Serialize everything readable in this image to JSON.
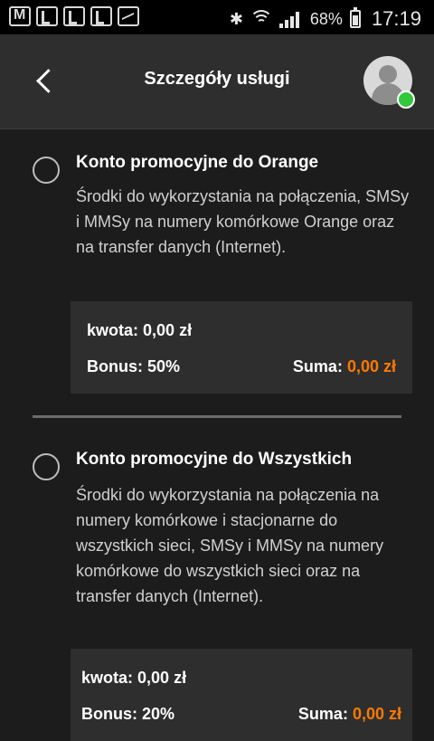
{
  "statusbar": {
    "battery": "68%",
    "time": "17:19",
    "icons": [
      "gmail-icon",
      "app-icon",
      "app-icon",
      "app-icon",
      "gallery-icon",
      "bluetooth-icon",
      "wifi-icon",
      "signal-icon",
      "battery-icon"
    ]
  },
  "header": {
    "title": "Szczegóły usługi"
  },
  "offers": [
    {
      "title": "Konto promocyjne do Orange",
      "description": "Środki do wykorzystania na połączenia, SMSy i MMSy na numery komórkowe Orange oraz na transfer danych (Internet).",
      "amount_label": "kwota:",
      "amount_value": "0,00 zł",
      "bonus_label": "Bonus:",
      "bonus_value": "50%",
      "sum_label": "Suma:",
      "sum_value": "0,00 zł"
    },
    {
      "title": "Konto promocyjne do Wszystkich",
      "description": "Środki do wykorzystania na połączenia na numery komórkowe i stacjonarne do wszystkich sieci, SMSy i MMSy na numery komórkowe do wszystkich sieci oraz na transfer danych (Internet).",
      "amount_label": "kwota:",
      "amount_value": "0,00 zł",
      "bonus_label": "Bonus:",
      "bonus_value": "20%",
      "sum_label": "Suma:",
      "sum_value": "0,00 zł"
    }
  ],
  "colors": {
    "accent": "#ff7900",
    "online": "#32c83c"
  }
}
